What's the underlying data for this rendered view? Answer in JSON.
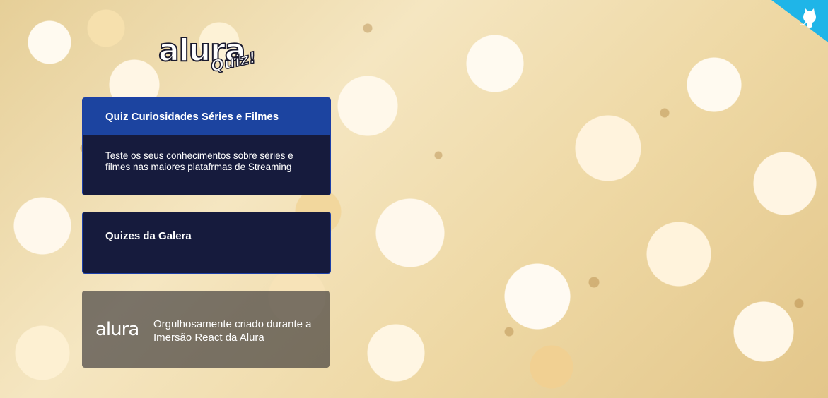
{
  "logo": {
    "main": "alura",
    "sub": "Quiz!"
  },
  "main_card": {
    "title": "Quiz Curiosidades Séries e Filmes",
    "description": "Teste os seus conhecimentos sobre séries e filmes nas maiores platafrmas de Streaming"
  },
  "galera_card": {
    "title": "Quizes da Galera"
  },
  "footer": {
    "logo": "alura",
    "text_prefix": "Orgulhosamente criado durante a",
    "link_text": "Imersão React da Alura"
  },
  "colors": {
    "card_header": "#1c44a0",
    "card_body": "#161b3d",
    "corner_banner": "#1fb5e8"
  },
  "icons": {
    "corner": "github-octocat-icon"
  }
}
